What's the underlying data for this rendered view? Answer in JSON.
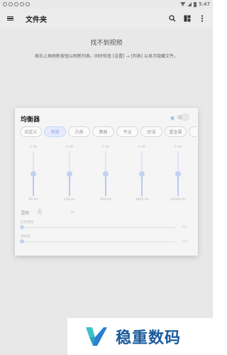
{
  "status_bar": {
    "time": "5:47"
  },
  "app_bar": {
    "title": "文件夹",
    "icons": [
      "menu-icon",
      "search-icon",
      "layout-icon",
      "more-vert-icon"
    ]
  },
  "empty_state": {
    "title": "找不到视频",
    "description": "按右上角刷新按钮以刷新列表。同时检查 [设置] → [列表] 以显示隐藏文件。"
  },
  "equalizer": {
    "title": "均衡器",
    "enable_label": "关",
    "enabled": false,
    "presets": [
      "自定义",
      "常规",
      "古典",
      "舞曲",
      "平淡",
      "民谣",
      "重金属",
      "嘻"
    ],
    "active_preset": 1,
    "bands": [
      {
        "db": "0 dB",
        "freq": "60 Hz",
        "level": 0.5
      },
      {
        "db": "0 dB",
        "freq": "230 Hz",
        "level": 0.5
      },
      {
        "db": "0 dB",
        "freq": "910 Hz",
        "level": 0.5
      },
      {
        "db": "0 dB",
        "freq": "3600 Hz",
        "level": 0.5
      },
      {
        "db": "0 dB",
        "freq": "14000 Hz",
        "level": 0.5
      }
    ],
    "reverb_label": "混响",
    "reverb_value": "无",
    "sliders": [
      {
        "label": "低音增强",
        "value": "0%",
        "level": 0
      },
      {
        "label": "虚拟器",
        "value": "0%",
        "level": 0
      }
    ]
  },
  "watermark": {
    "text": "稳重数码",
    "colors": {
      "teal": "#3ec1c9",
      "blue": "#2a7fd0"
    }
  }
}
